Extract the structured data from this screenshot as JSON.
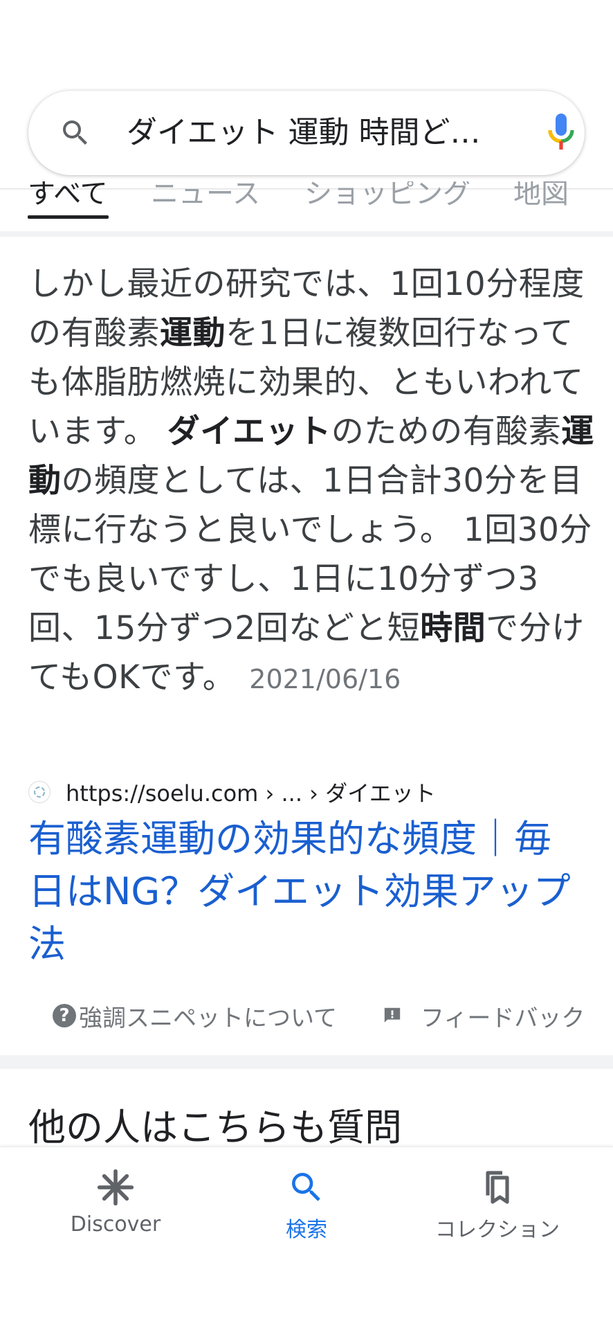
{
  "search": {
    "query": "ダイエット 運動 時間ど…",
    "icons": {
      "search": "search-icon",
      "mic": "mic-icon"
    }
  },
  "tabs": [
    {
      "label": "すべて",
      "active": true
    },
    {
      "label": "ニュース",
      "active": false
    },
    {
      "label": "ショッピング",
      "active": false
    },
    {
      "label": "地図",
      "active": false
    }
  ],
  "snippet": {
    "t1": "しかし最近の研究では、1回10分程度の有酸素",
    "b1": "運動",
    "t2": "を1日に複数回行なっても体脂肪燃焼に効果的、ともいわれています。 ",
    "b2": "ダイエット",
    "t3": "のための有酸素",
    "b3": "運動",
    "t4": "の頻度としては、1日合計30分を目標に行なうと良いでしょう。 1回30分でも良いですし、1日に10分ずつ3回、15分ずつ2回などと短",
    "b4": "時間",
    "t5": "で分けてもOKです。",
    "date": "2021/06/16"
  },
  "source": {
    "url": "https://soelu.com › ... › ダイエット"
  },
  "result": {
    "title": "有酸素運動の効果的な頻度｜毎日はNG？ダイエット効果アップ法"
  },
  "footer": {
    "about_snippets": "強調スニペットについて",
    "feedback": "フィードバック"
  },
  "paa": {
    "heading": "他の人はこちらも質問"
  },
  "bottom_nav": [
    {
      "label": "Discover",
      "icon": "asterisk-icon",
      "active": false
    },
    {
      "label": "検索",
      "icon": "search-icon",
      "active": true
    },
    {
      "label": "コレクション",
      "icon": "bookmarks-icon",
      "active": false
    }
  ],
  "colors": {
    "link": "#1a5fd0",
    "active_nav": "#1a73e8",
    "text": "#3c4043"
  }
}
